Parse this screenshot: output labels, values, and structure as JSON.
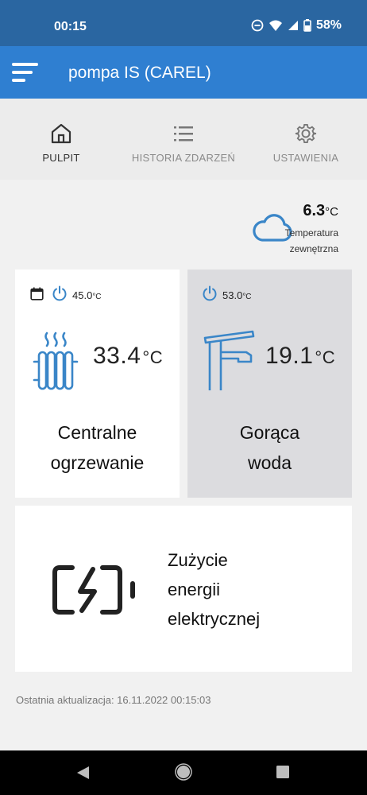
{
  "status_bar": {
    "time": "00:15",
    "battery": "58%"
  },
  "app_bar": {
    "title": "pompa IS (CAREL)"
  },
  "tabs": [
    {
      "label": "PULPIT",
      "icon": "home-icon",
      "active": true
    },
    {
      "label": "HISTORIA ZDARZEŃ",
      "icon": "list-icon",
      "active": false
    },
    {
      "label": "USTAWIENIA",
      "icon": "gear-icon",
      "active": false
    }
  ],
  "weather": {
    "value": "6.3",
    "unit": "°C",
    "label_line1": "Temperatura",
    "label_line2": "zewnętrzna",
    "icon": "cloud-icon"
  },
  "central_heating": {
    "setpoint": "45.0",
    "setpoint_unit": "°C",
    "temperature": "33.4",
    "unit": "°C",
    "title_line1": "Centralne",
    "title_line2": "ogrzewanie",
    "icon": "radiator-icon"
  },
  "hot_water": {
    "setpoint": "53.0",
    "setpoint_unit": "°C",
    "temperature": "19.1",
    "unit": "°C",
    "title_line1": "Gorąca",
    "title_line2": "woda",
    "icon": "faucet-icon"
  },
  "energy": {
    "line1": "Zużycie",
    "line2": "energii",
    "line3": "elektrycznej",
    "icon": "battery-charging-icon"
  },
  "footer": {
    "last_update": "Ostatnia aktualizacja: 16.11.2022 00:15:03"
  },
  "colors": {
    "status_bar": "#2a66a1",
    "app_bar": "#2f7fd1",
    "accent_icon": "#3a86c8",
    "hot_water_card": "#dcdcdf"
  }
}
